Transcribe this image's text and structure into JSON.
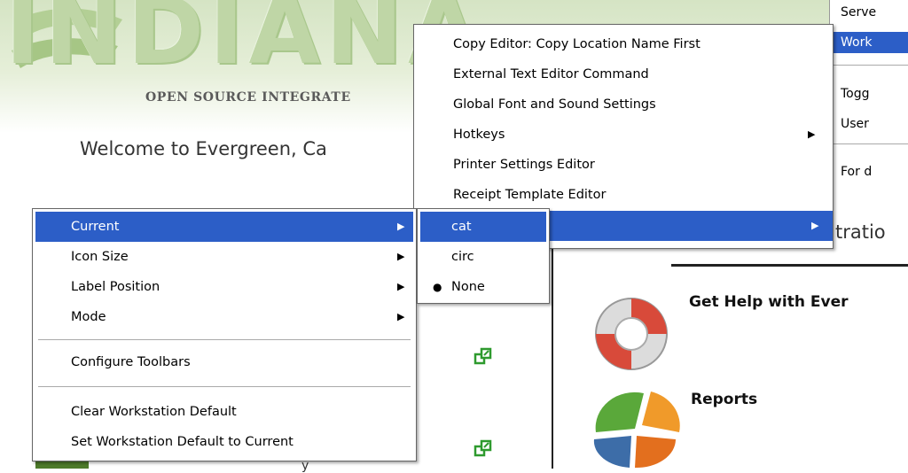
{
  "page": {
    "logo_text": "INDIANA",
    "logo_subtitle": "OPEN SOURCE INTEGRATE",
    "welcome": "Welcome to Evergreen, Ca",
    "admin_partial": "tratio",
    "help_title": "Get Help with Ever",
    "reports_title": "Reports",
    "bottom_partial": "y"
  },
  "top_right_menu": {
    "items": [
      {
        "label": "Serve",
        "highlighted": false
      },
      {
        "label": "Work",
        "highlighted": true
      },
      {
        "label": "Togg",
        "highlighted": false
      },
      {
        "label": "User",
        "highlighted": false
      },
      {
        "label": "For d",
        "highlighted": false
      }
    ]
  },
  "preferences_menu": {
    "items": [
      {
        "label": "Copy Editor: Copy Location Name First",
        "submenu": false
      },
      {
        "label": "External Text Editor Command",
        "submenu": false
      },
      {
        "label": "Global Font and Sound Settings",
        "submenu": false
      },
      {
        "label": "Hotkeys",
        "submenu": true
      },
      {
        "label": "Printer Settings Editor",
        "submenu": false
      },
      {
        "label": "Receipt Template Editor",
        "submenu": false
      },
      {
        "label": "",
        "submenu": true,
        "highlighted": true
      }
    ]
  },
  "toolbar_menu": {
    "items": [
      {
        "label": "Current",
        "submenu": true,
        "highlighted": true
      },
      {
        "label": "Icon Size",
        "submenu": true
      },
      {
        "label": "Label Position",
        "submenu": true
      },
      {
        "label": "Mode",
        "submenu": true
      },
      {
        "label": "Configure Toolbars",
        "submenu": false
      },
      {
        "label": "Clear Workstation Default",
        "submenu": false
      },
      {
        "label": "Set Workstation Default to Current",
        "submenu": false
      }
    ]
  },
  "current_submenu": {
    "items": [
      {
        "label": "cat",
        "highlighted": true,
        "checked": false
      },
      {
        "label": "circ",
        "highlighted": false,
        "checked": false
      },
      {
        "label": "None",
        "highlighted": false,
        "checked": true
      }
    ]
  },
  "colors": {
    "highlight": "#2c5ec7",
    "banner_green": "#d5e4c4"
  },
  "icons": [
    "lifebuoy-icon",
    "reports-pie-icon",
    "open-window-icon",
    "submenu-arrow-icon",
    "radio-bullet-icon"
  ]
}
